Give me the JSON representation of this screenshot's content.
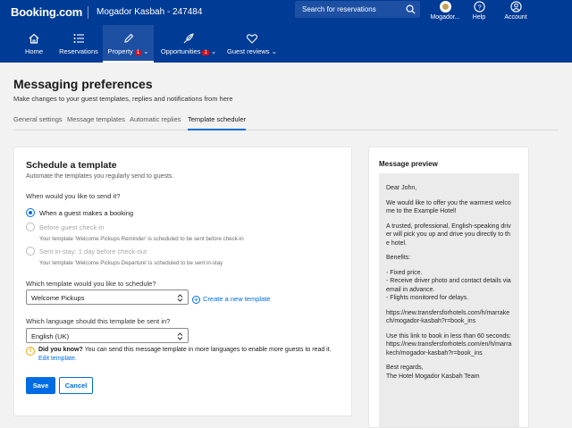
{
  "header": {
    "logo": "Booking.com",
    "property_name": "Mogador Kasbah - 247484",
    "search_placeholder": "Search for reservations",
    "account_short": "Mogador...",
    "help_label": "Help",
    "account_label": "Account"
  },
  "nav": {
    "items": [
      {
        "label": "Home",
        "icon": "home-icon"
      },
      {
        "label": "Reservations",
        "icon": "list-icon"
      },
      {
        "label": "Property",
        "icon": "pencil-icon",
        "badge": "1"
      },
      {
        "label": "Opportunities",
        "icon": "rocket-icon",
        "badge": "1"
      },
      {
        "label": "Guest reviews",
        "icon": "heart-icon"
      }
    ]
  },
  "page": {
    "title": "Messaging preferences",
    "subtitle": "Make changes to your guest templates, replies and notifications from here",
    "tabs": [
      "General settings",
      "Message templates",
      "Automatic replies",
      "Template scheduler"
    ],
    "active_tab": "Template scheduler"
  },
  "form": {
    "title": "Schedule a template",
    "subtitle": "Automate the templates you regularly send to guests.",
    "when_label": "When would you like to send it?",
    "options": [
      {
        "label": "When a guest makes a booking",
        "checked": true,
        "disabled": false,
        "note": ""
      },
      {
        "label": "Before guest check-in",
        "checked": false,
        "disabled": true,
        "note": "Your template 'Welcome Pickups Reminder' is scheduled to be sent before check-in"
      },
      {
        "label": "Sent in-stay: 1 day before check-out",
        "checked": false,
        "disabled": true,
        "note": "Your template 'Welcome Pickups Departure' is scheduled to be sent in-stay"
      }
    ],
    "template_label": "Which template would you like to schedule?",
    "template_value": "Welcome Pickups",
    "create_link": "Create a new template",
    "language_label": "Which language should this template be sent in?",
    "language_value": "English (UK)",
    "info_bold": "Did you know?",
    "info_text": "You can send this message template in more languages to enable more guests to read it.",
    "info_link": "Edit template.",
    "save_label": "Save",
    "cancel_label": "Cancel"
  },
  "preview": {
    "title": "Message preview",
    "paragraphs": [
      "Dear John,",
      "We would like to offer you the warmest welcome to the Example Hotel!",
      "A trusted, professional, English-speaking driver will pick you up and drive you directly to the hotel.",
      "Benefits:",
      "- Fixed price.\n- Receive driver photo and contact details via email in advance.\n- Flights monitored for delays.",
      "https://new.transfersforhotels.com/h/marrakech/mogador-kasbah?r=book_ins",
      "Use this link to book in less than 60 seconds:\nhttps://new.transfersforhotels.com/en/h/marrakech/mogador-kasbah?r=book_ins",
      "Best regards,\nThe Hotel Mogador Kasbah Team"
    ]
  },
  "colors": {
    "brand": "#003b95",
    "accent": "#006ce4",
    "badge": "#d4111e"
  }
}
